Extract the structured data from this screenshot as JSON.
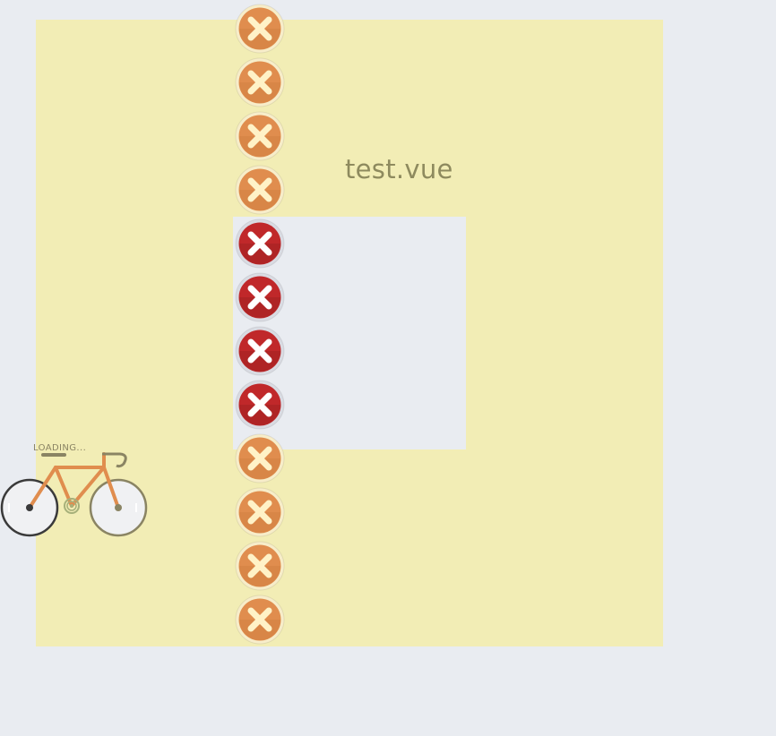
{
  "title": "test.vue",
  "loading": {
    "text": "LOADING..."
  },
  "close_buttons": [
    {
      "label": "close",
      "style": "orange"
    },
    {
      "label": "close",
      "style": "orange"
    },
    {
      "label": "close",
      "style": "orange"
    },
    {
      "label": "close",
      "style": "orange"
    },
    {
      "label": "close",
      "style": "red"
    },
    {
      "label": "close",
      "style": "red"
    },
    {
      "label": "close",
      "style": "red"
    },
    {
      "label": "close",
      "style": "red"
    },
    {
      "label": "close",
      "style": "orange"
    },
    {
      "label": "close",
      "style": "orange"
    },
    {
      "label": "close",
      "style": "orange"
    },
    {
      "label": "close",
      "style": "orange"
    }
  ],
  "colors": {
    "background": "#e9ecf1",
    "panel": "#f2edb5",
    "title": "#8e8a5e",
    "orange_button": "#e08d4e",
    "red_button": "#c0282a",
    "bike_frame": "#e08d4e"
  }
}
